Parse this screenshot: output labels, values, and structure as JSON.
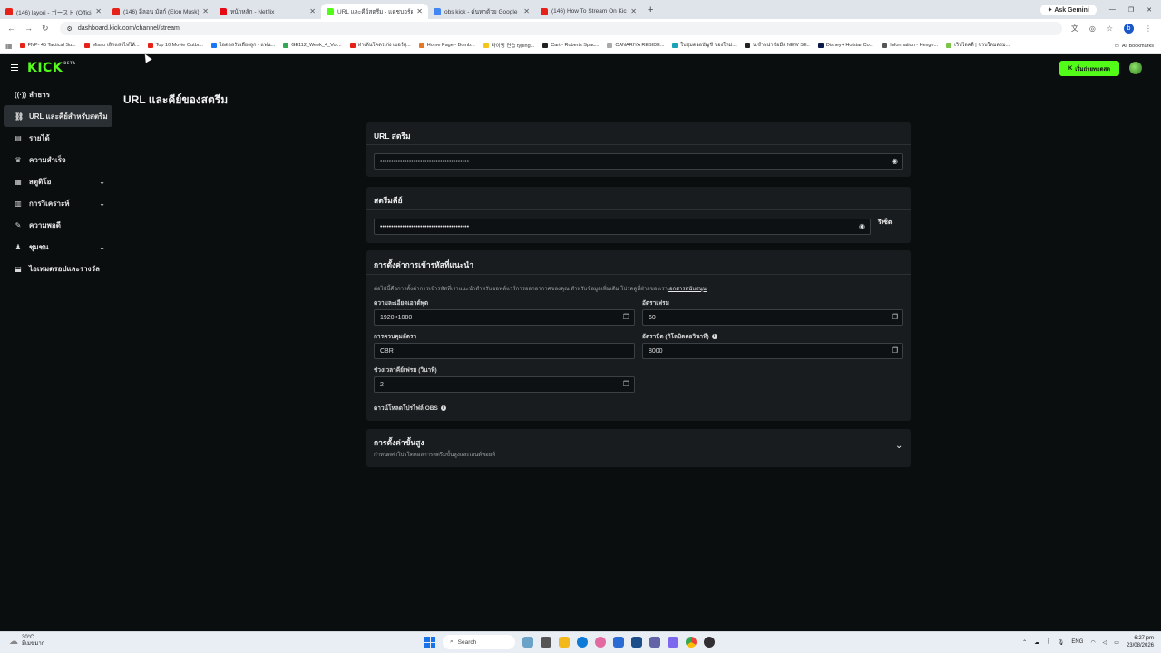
{
  "browser": {
    "tabs": [
      {
        "title": "(146) layori - ゴースト (Official Vi",
        "color": "#e62117"
      },
      {
        "title": "(146) อีลอน มัสก์ (Elon Musk) ละ",
        "color": "#e62117"
      },
      {
        "title": "หน้าหลัก - Netflix",
        "color": "#e50914"
      },
      {
        "title": "URL และคีย์สตรีม - แดชบอร์ด Kick",
        "color": "#53fc18"
      },
      {
        "title": "obs kick - ค้นหาด้วย Google",
        "color": "#4285f4"
      },
      {
        "title": "(146) How To Stream On Kick U",
        "color": "#e62117"
      }
    ],
    "new_tab": "+",
    "ask_gemini": "Ask Gemini",
    "url": "dashboard.kick.com/channel/stream",
    "profile_initial": "b",
    "bookmarks": [
      {
        "label": "FNP- 45 Tactical Su...",
        "color": "#e62117"
      },
      {
        "label": "Misao เลิกแสงไฟได้...",
        "color": "#e62117"
      },
      {
        "label": "Top 10 Movie Outbr...",
        "color": "#e62117"
      },
      {
        "label": "ไอดอลรับเลี้ยงลูก - แฟน...",
        "color": "#1877f2"
      },
      {
        "label": "GE112_Week_4_Vot...",
        "color": "#34a853"
      },
      {
        "label": "ท่าเต้นโคตรเก่ง เบอร์สุ...",
        "color": "#e62117"
      },
      {
        "label": "Home Page - Bomb...",
        "color": "#e87722"
      },
      {
        "label": "타이핑 연습 typing...",
        "color": "#f5c518"
      },
      {
        "label": "Cart - Roberts Spac...",
        "color": "#222222"
      },
      {
        "label": "CANARIYA RESIDE...",
        "color": "#aaaaaa"
      },
      {
        "label": "ใบทุมดลอบัญชี ของใหม่...",
        "color": "#17a2b8"
      },
      {
        "label": "น.ซ้ำหน่าข้อมือ NEW SE...",
        "color": "#222222"
      },
      {
        "label": "Disney+ Hotstar Co...",
        "color": "#0b1a4a"
      },
      {
        "label": "Information - Hexge...",
        "color": "#555555"
      },
      {
        "label": "เว็บไลคลิ้ | ขวบใตมดรม...",
        "color": "#7cc44a"
      }
    ],
    "all_bookmarks": "All Bookmarks"
  },
  "kick": {
    "logo": "KICK",
    "logo_badge": "BETA",
    "go_live": "เริ่มถ่ายทอดสด",
    "accent": "#53fc18",
    "sidebar": [
      {
        "icon": "live-icon",
        "glyph": "((·))",
        "label": "ลำธาร",
        "chevron": false
      },
      {
        "icon": "link-icon",
        "glyph": "⛓",
        "label": "URL และคีย์สำหรับสตรีม",
        "chevron": false,
        "active": true
      },
      {
        "icon": "revenue-icon",
        "glyph": "▤",
        "label": "รายได้",
        "chevron": false
      },
      {
        "icon": "trophy-icon",
        "glyph": "♛",
        "label": "ความสำเร็จ",
        "chevron": false
      },
      {
        "icon": "studio-icon",
        "glyph": "▦",
        "label": "สตูดิโอ",
        "chevron": true
      },
      {
        "icon": "analytics-icon",
        "glyph": "▥",
        "label": "การวิเคราะห์",
        "chevron": true
      },
      {
        "icon": "wrench-icon",
        "glyph": "✎",
        "label": "ความพอดี",
        "chevron": false
      },
      {
        "icon": "community-icon",
        "glyph": "♟",
        "label": "ชุมชน",
        "chevron": true
      },
      {
        "icon": "rewards-icon",
        "glyph": "⬓",
        "label": "ไอเทมดรอปและรางวัล",
        "chevron": false
      }
    ],
    "page_title": "URL และคีย์ของสตรีม",
    "stream_url": {
      "heading": "URL สตรีม",
      "value": "••••••••••••••••••••••••••••••••••••••••"
    },
    "stream_key": {
      "heading": "สตรีมคีย์",
      "value": "••••••••••••••••••••••••••••••••••••••••",
      "reset": "รีเซ็ต"
    },
    "recommended": {
      "heading": "การตั้งค่าการเข้ารหัสที่แนะนำ",
      "description": "ต่อไปนี้คือการตั้งค่าการเข้ารหัสที่เราแนะนำสำหรับซอฟต์แวร์การออกอากาศของคุณ สำหรับข้อมูลเพิ่มเติม โปรดดูที่ฝ่ายของเรา",
      "description_link": "เอกสารสนับสนุน",
      "resolution_label": "ความละเอียดเอาต์พุต",
      "resolution_value": "1920×1080",
      "framerate_label": "อัตราเฟรม",
      "framerate_value": "60",
      "ratecontrol_label": "การควบคุมอัตรา",
      "ratecontrol_value": "CBR",
      "bitrate_label": "อัตราบิต (กิโลบิตต่อวินาที)",
      "bitrate_value": "8000",
      "keyframe_label": "ช่วงเวลาคีย์เฟรม (วินาที)",
      "keyframe_value": "2",
      "obs_profile": "ดาวน์โหลดโปรไฟล์ OBS"
    },
    "advanced": {
      "heading": "การตั้งค่าขั้นสูง",
      "subtitle": "กำหนดค่าโปรโตคอลการสตรีมขั้นสูงและเอนด์พอยต์"
    }
  },
  "taskbar": {
    "temp": "30°C",
    "weather": "มีเมฆมาก",
    "search": "Search",
    "lang": "ENG",
    "time": "6:27 pm",
    "date": "23/08/2026"
  }
}
